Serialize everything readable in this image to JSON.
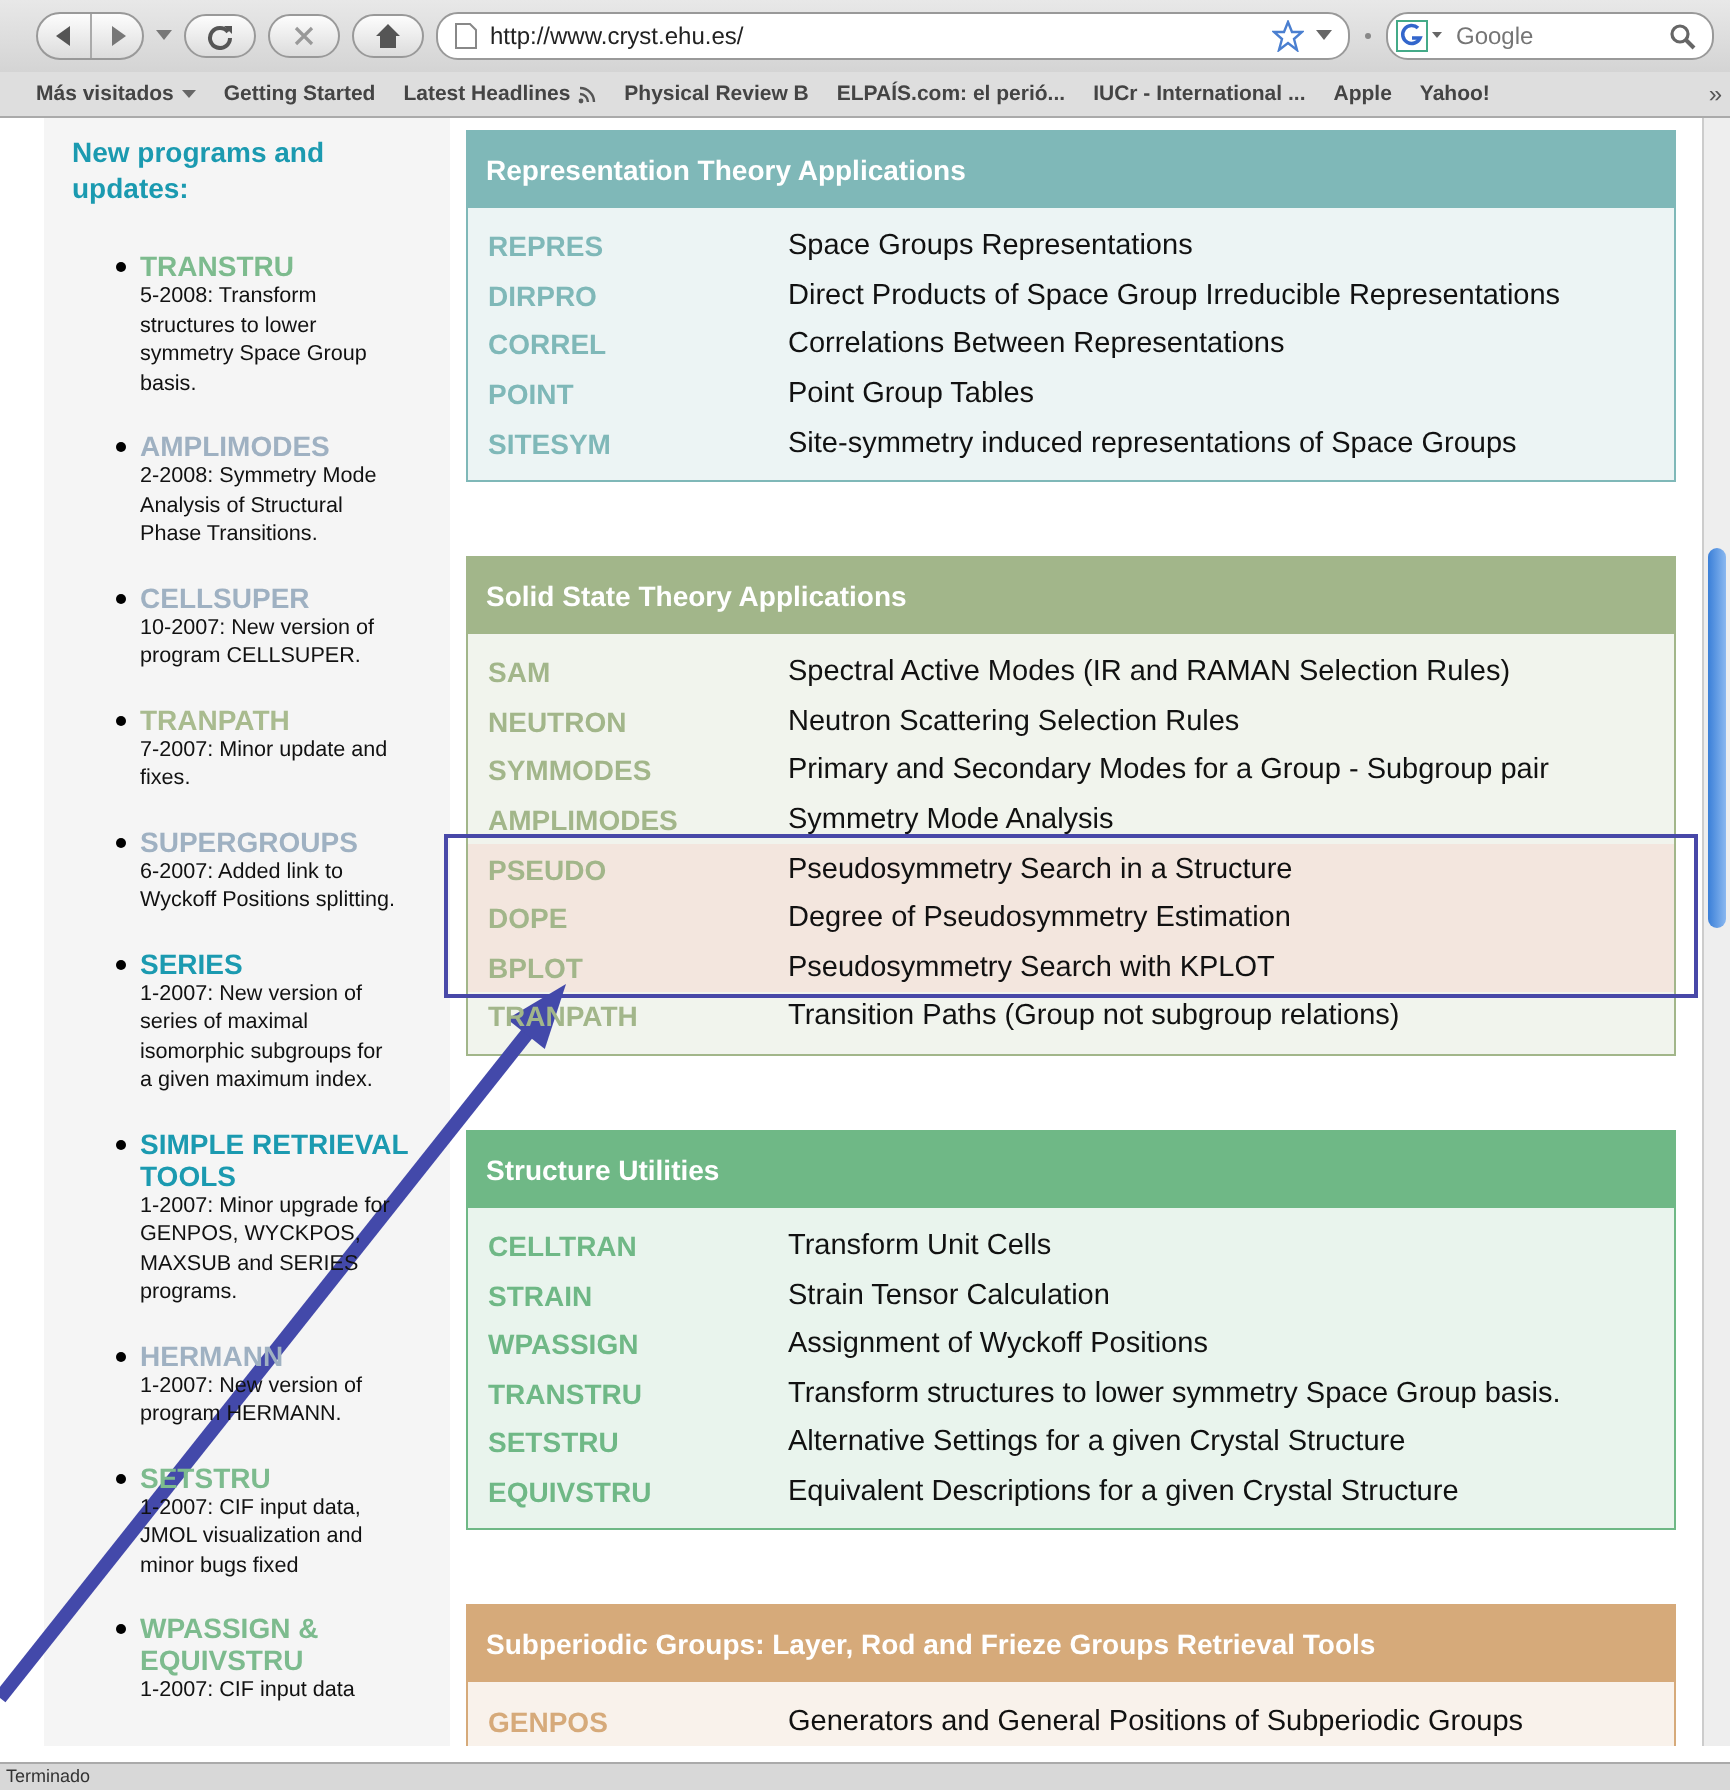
{
  "browser": {
    "url": "http://www.cryst.ehu.es/",
    "search_placeholder": "Google",
    "bookmarks": [
      {
        "label": "Más visitados",
        "kind": "menu"
      },
      {
        "label": "Getting Started",
        "kind": "plain"
      },
      {
        "label": "Latest Headlines",
        "kind": "feed"
      },
      {
        "label": "Physical Review B",
        "kind": "plain"
      },
      {
        "label": "ELPAÍS.com: el perió...",
        "kind": "plain"
      },
      {
        "label": "IUCr - International ...",
        "kind": "plain"
      },
      {
        "label": "Apple",
        "kind": "plain"
      },
      {
        "label": "Yahoo!",
        "kind": "plain"
      }
    ],
    "more": "»",
    "status": "Terminado"
  },
  "sidebar": {
    "title": "New programs and updates:",
    "items": [
      {
        "name": "TRANSTRU",
        "color": "#7dbb8e",
        "text": "5-2008: Transform structures to lower symmetry Space Group basis."
      },
      {
        "name": "AMPLIMODES",
        "color": "#9fb1c2",
        "text": "2-2008: Symmetry Mode Analysis of Structural Phase Transitions."
      },
      {
        "name": "CELLSUPER",
        "color": "#9fb1c2",
        "text": "10-2007: New version of program CELLSUPER."
      },
      {
        "name": "TRANPATH",
        "color": "#a9bb8f",
        "text": "7-2007: Minor update and fixes."
      },
      {
        "name": "SUPERGROUPS",
        "color": "#9fb1c2",
        "text": "6-2007: Added link to Wyckoff Positions splitting."
      },
      {
        "name": "SERIES",
        "color": "#1b9ab0",
        "text": "1-2007: New version of series of maximal isomorphic subgroups for a given maximum index."
      },
      {
        "name": "SIMPLE RETRIEVAL TOOLS",
        "color": "#1b9ab0",
        "text": "1-2007: Minor upgrade for GENPOS, WYCKPOS, MAXSUB and SERIES programs."
      },
      {
        "name": "HERMANN",
        "color": "#9fb1c2",
        "text": "1-2007: New version of program HERMANN."
      },
      {
        "name": "SETSTRU",
        "color": "#7dbb8e",
        "text": "1-2007: CIF input data, JMOL visualization and minor bugs fixed"
      },
      {
        "name": "WPASSIGN & EQUIVSTRU",
        "color": "#7dbb8e",
        "text": "1-2007: CIF input data"
      }
    ]
  },
  "sections": [
    {
      "title": "Representation Theory Applications",
      "color": "#7fb8b8",
      "rows": [
        {
          "name": "REPRES",
          "description": "Space Groups Representations",
          "highlighted": false
        },
        {
          "name": "DIRPRO",
          "description": "Direct Products of Space Group Irreducible Representations",
          "highlighted": false
        },
        {
          "name": "CORREL",
          "description": "Correlations Between Representations",
          "highlighted": false
        },
        {
          "name": "POINT",
          "description": "Point Group Tables",
          "highlighted": false
        },
        {
          "name": "SITESYM",
          "description": "Site-symmetry induced representations of Space Groups",
          "highlighted": false
        }
      ]
    },
    {
      "title": "Solid State Theory Applications",
      "color": "#a2b68a",
      "rows": [
        {
          "name": "SAM",
          "description": "Spectral Active Modes (IR and RAMAN Selection Rules)",
          "highlighted": false
        },
        {
          "name": "NEUTRON",
          "description": "Neutron Scattering Selection Rules",
          "highlighted": false
        },
        {
          "name": "SYMMODES",
          "description": "Primary and Secondary Modes for a Group - Subgroup pair",
          "highlighted": false
        },
        {
          "name": "AMPLIMODES",
          "description": "Symmetry Mode Analysis",
          "highlighted": false
        },
        {
          "name": "PSEUDO",
          "description": "Pseudosymmetry Search in a Structure",
          "highlighted": true
        },
        {
          "name": "DOPE",
          "description": "Degree of Pseudosymmetry Estimation",
          "highlighted": true
        },
        {
          "name": "BPLOT",
          "description": "Pseudosymmetry Search with KPLOT",
          "highlighted": true
        },
        {
          "name": "TRANPATH",
          "description": "Transition Paths (Group not subgroup relations)",
          "highlighted": false
        }
      ]
    },
    {
      "title": "Structure Utilities",
      "color": "#6fb886",
      "rows": [
        {
          "name": "CELLTRAN",
          "description": "Transform Unit Cells",
          "highlighted": false
        },
        {
          "name": "STRAIN",
          "description": "Strain Tensor Calculation",
          "highlighted": false
        },
        {
          "name": "WPASSIGN",
          "description": "Assignment of Wyckoff Positions",
          "highlighted": false
        },
        {
          "name": "TRANSTRU",
          "description": "Transform structures to lower symmetry Space Group basis.",
          "highlighted": false
        },
        {
          "name": "SETSTRU",
          "description": "Alternative Settings for a given Crystal Structure",
          "highlighted": false
        },
        {
          "name": "EQUIVSTRU",
          "description": "Equivalent Descriptions for a given Crystal Structure",
          "highlighted": false
        }
      ]
    },
    {
      "title": "Subperiodic Groups: Layer, Rod and Frieze Groups Retrieval Tools",
      "color": "#d6aa7a",
      "rows": [
        {
          "name": "GENPOS",
          "description": "Generators and General Positions of Subperiodic Groups",
          "highlighted": false
        }
      ]
    }
  ]
}
